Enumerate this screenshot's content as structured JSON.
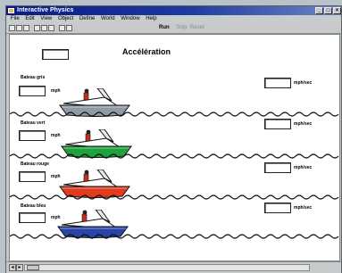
{
  "window": {
    "title": "Interactive Physics"
  },
  "menu": [
    "File",
    "Edit",
    "View",
    "Object",
    "Define",
    "World",
    "Window",
    "Help"
  ],
  "toolbar": {
    "run_label": "Run",
    "stop_label": "Stop",
    "reset_label": "Reset"
  },
  "page": {
    "title": "Accélération"
  },
  "unit_left": "mph",
  "unit_right": "mph/sec",
  "boats": [
    {
      "label": "Bateau gris",
      "color": "#8e9aa6"
    },
    {
      "label": "Bateau vert",
      "color": "#1fa23c"
    },
    {
      "label": "Bateau rouge",
      "color": "#e23a1c"
    },
    {
      "label": "Bateau bleu",
      "color": "#2a45a8"
    }
  ]
}
